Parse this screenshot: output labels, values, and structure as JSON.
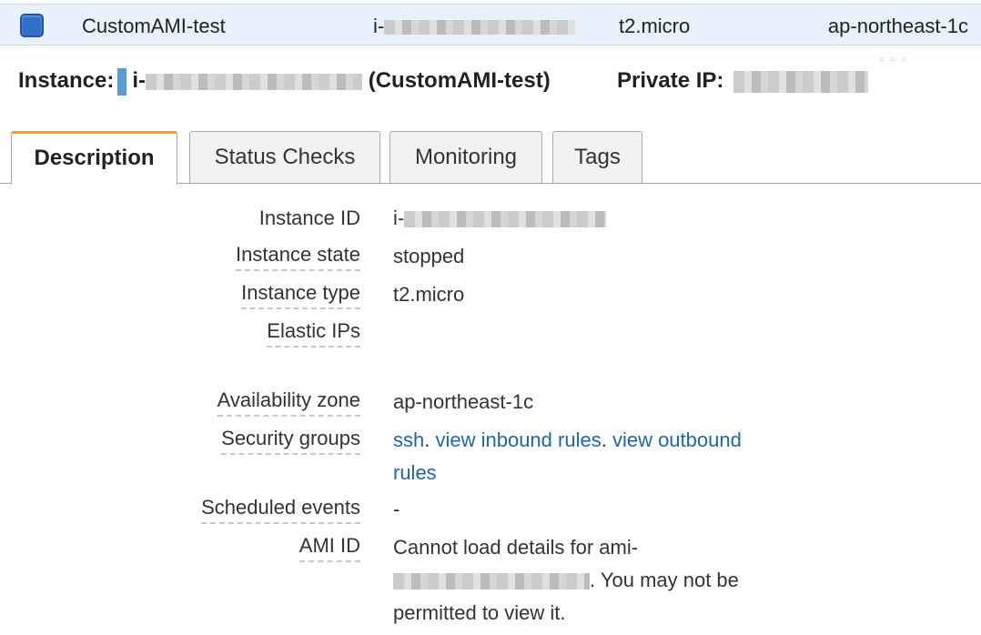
{
  "instance_row": {
    "name": "CustomAMI-test",
    "id_prefix": "i-",
    "type": "t2.micro",
    "availability_zone": "ap-northeast-1c"
  },
  "header": {
    "instance_label": "Instance:",
    "id_prefix": "i-",
    "name_suffix": "(CustomAMI-test)",
    "private_ip_label": "Private IP:"
  },
  "tabs": [
    {
      "label": "Description",
      "active": true
    },
    {
      "label": "Status Checks",
      "active": false
    },
    {
      "label": "Monitoring",
      "active": false
    },
    {
      "label": "Tags",
      "active": false
    }
  ],
  "details": {
    "instance_id": {
      "label": "Instance ID",
      "value_prefix": "i-"
    },
    "instance_state": {
      "label": "Instance state",
      "value": "stopped"
    },
    "instance_type": {
      "label": "Instance type",
      "value": "t2.micro"
    },
    "elastic_ips": {
      "label": "Elastic IPs",
      "value": ""
    },
    "availability_zone": {
      "label": "Availability zone",
      "value": "ap-northeast-1c"
    },
    "security_groups": {
      "label": "Security groups",
      "group_link": "ssh",
      "sep1": ". ",
      "inbound_link": "view inbound rules",
      "sep2": ". ",
      "outbound_link": "view outbound rules"
    },
    "scheduled_events": {
      "label": "Scheduled events",
      "value": "-"
    },
    "ami_id": {
      "label": "AMI ID",
      "text_before": "Cannot load details for ami-",
      "text_after": ". You may not be permitted to view it."
    }
  },
  "colors": {
    "selected_row_bg": "#e8f1fb",
    "checkbox": "#2f6fc6",
    "link": "#1f63b1",
    "active_tab_accent": "#f0a030"
  }
}
